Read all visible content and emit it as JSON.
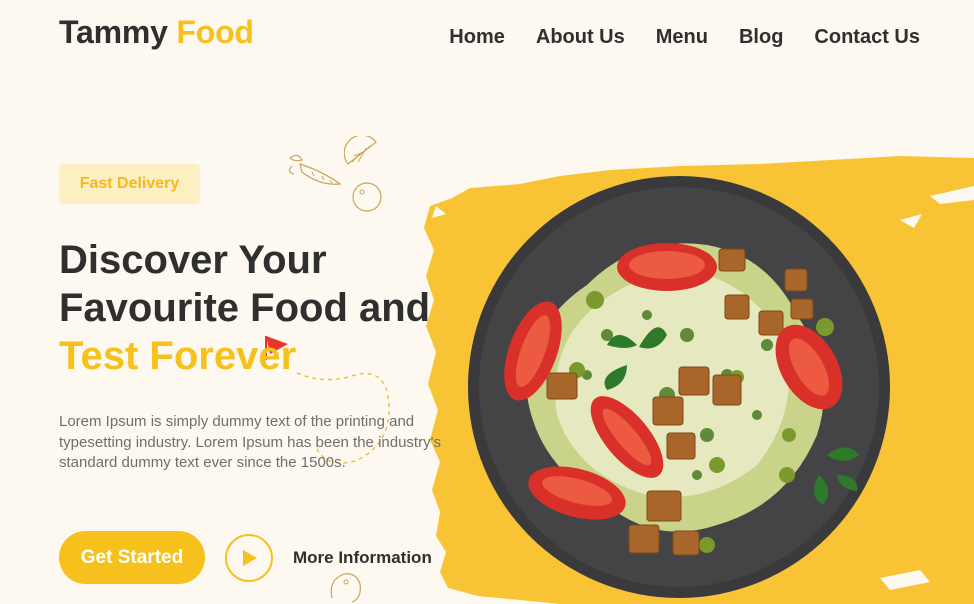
{
  "header": {
    "logo_main": "Tammy",
    "logo_accent": "Food",
    "nav": [
      "Home",
      "About Us",
      "Menu",
      "Blog",
      "Contact Us"
    ]
  },
  "hero": {
    "badge": "Fast Delivery",
    "headline_line1": "Discover Your",
    "headline_line2": "Favourite Food and",
    "headline_line3": "Test Forever",
    "description": "Lorem Ipsum is simply dummy text of the printing and typesetting industry. Lorem Ipsum has been the industry's standard dummy text ever since the 1500s.",
    "cta_primary": "Get Started",
    "cta_secondary": "More Information"
  },
  "icons": {
    "play": "play-icon",
    "doodles": [
      "carrot-icon",
      "lemon-icon",
      "pea-icon",
      "flag-icon",
      "sausage-icon"
    ],
    "image": "salad-plate"
  },
  "colors": {
    "background": "#fdf9f0",
    "accent": "#f6c11d",
    "badge_bg": "#fdefc4",
    "text_dark": "#2f2f2f",
    "text_muted": "#6f6f6f",
    "plate": "#3a3a3c",
    "flag": "#e8352d"
  }
}
